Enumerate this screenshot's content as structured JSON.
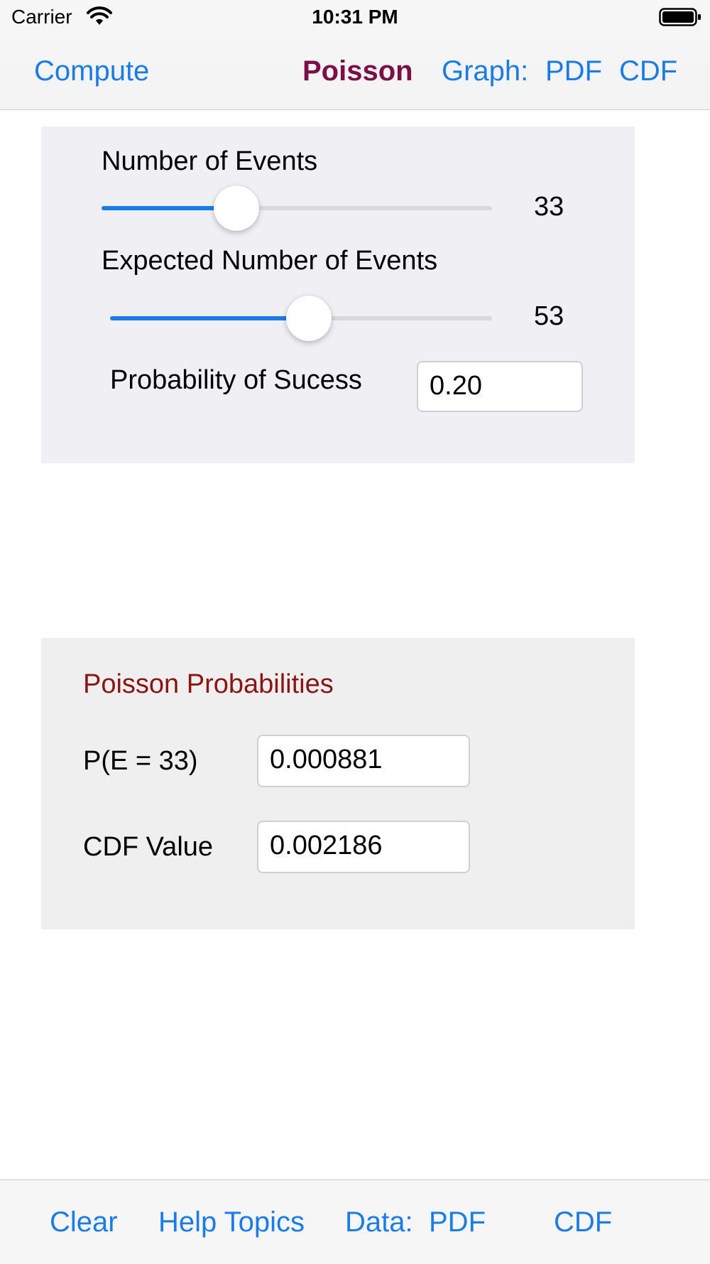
{
  "status_bar": {
    "carrier": "Carrier",
    "time": "10:31 PM"
  },
  "nav": {
    "compute": "Compute",
    "title": "Poisson",
    "graph_label": "Graph:",
    "graph_pdf": "PDF",
    "graph_cdf": "CDF"
  },
  "inputs": {
    "events_label": "Number of Events",
    "events_value": "33",
    "events_slider_fraction": 0.345,
    "expected_label": "Expected Number of Events",
    "expected_value": "53",
    "expected_slider_fraction": 0.52,
    "prob_label": "Probability of Sucess",
    "prob_value": "0.20"
  },
  "results": {
    "title": "Poisson Probabilities",
    "pe_label": "P(E = 33)",
    "pe_value": "0.000881",
    "cdf_label": "CDF Value",
    "cdf_value": "0.002186"
  },
  "toolbar": {
    "clear": "Clear",
    "help": "Help Topics",
    "data_label": "Data:",
    "data_pdf": "PDF",
    "data_cdf": "CDF"
  },
  "colors": {
    "accent": "#1a7ce8",
    "title": "#7a1046",
    "section_title": "#8b1414"
  },
  "icons": {
    "wifi": "wifi-icon",
    "battery": "battery-icon"
  }
}
